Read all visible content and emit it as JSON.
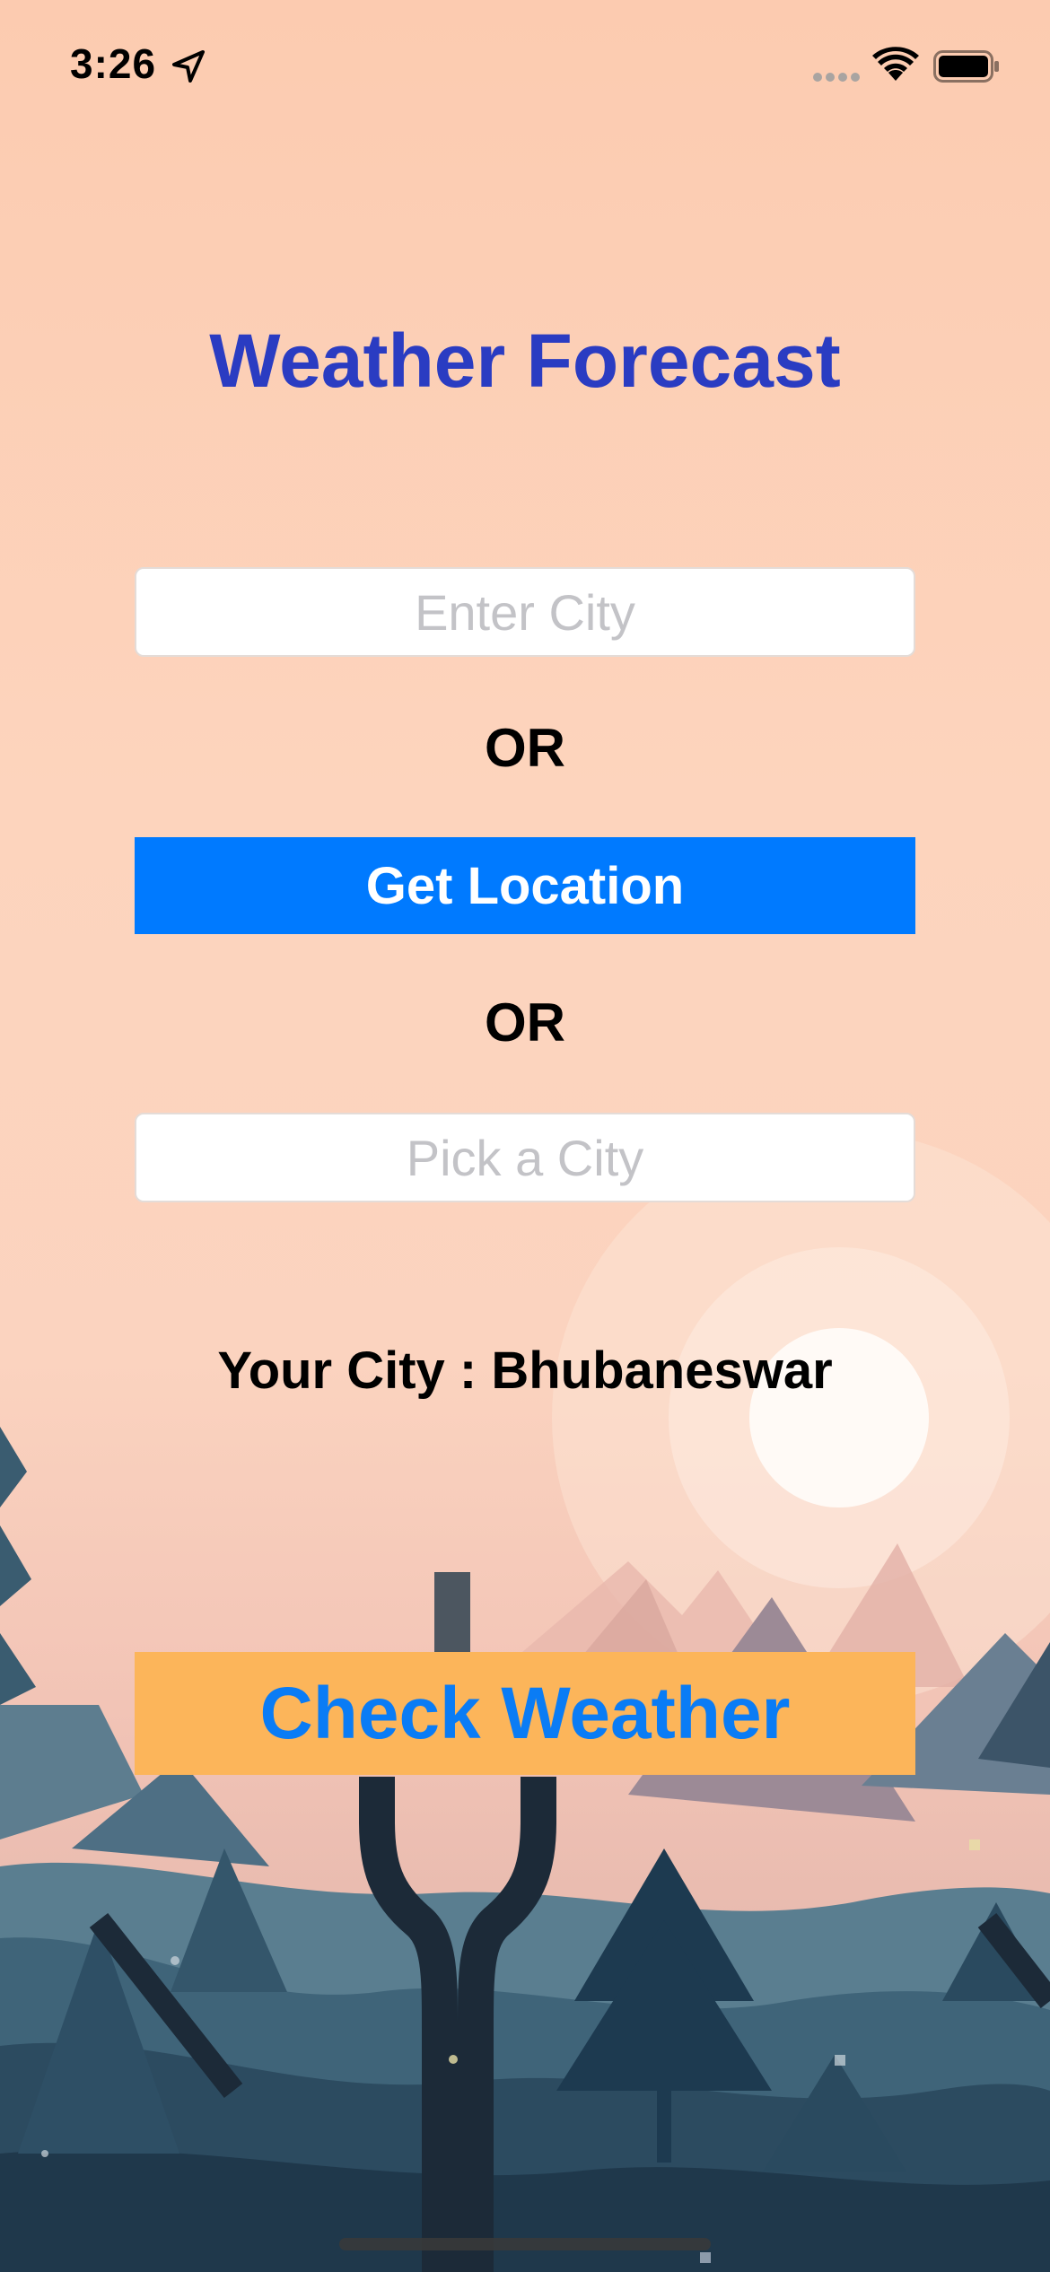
{
  "status_bar": {
    "time": "3:26",
    "location_icon": "location-arrow-icon",
    "signal_icon": "cellular-signal-icon",
    "wifi_icon": "wifi-icon",
    "battery_icon": "battery-icon"
  },
  "title": "Weather Forecast",
  "city_input": {
    "value": "",
    "placeholder": "Enter City"
  },
  "or_label_1": "OR",
  "get_location_label": "Get Location",
  "or_label_2": "OR",
  "pick_city": {
    "value": "",
    "placeholder": "Pick a City"
  },
  "your_city_text": "Your City : Bhubaneswar",
  "check_weather_label": "Check Weather",
  "colors": {
    "title": "#2a3cc2",
    "get_location_bg": "#007aff",
    "check_weather_bg": "#fcb55a",
    "check_weather_text": "#0a7cf5",
    "background_peach": "#fccbb0"
  },
  "background_art": "landscape-illustration"
}
